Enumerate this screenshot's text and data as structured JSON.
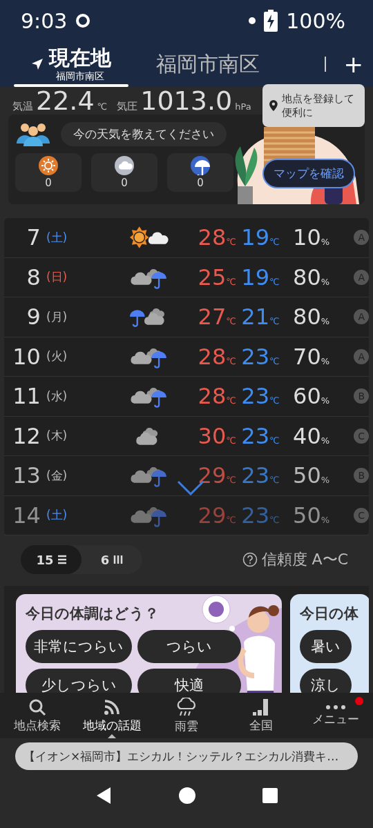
{
  "status_bar": {
    "time": "9:03",
    "battery": "100%"
  },
  "tabs": [
    {
      "label": "現在地",
      "sublabel": "福岡市南区",
      "selected": true
    },
    {
      "label": "福岡市南区",
      "selected": false
    }
  ],
  "add_button": "+",
  "current": {
    "temp_label": "気温",
    "temp": "22.4",
    "temp_unit": "℃",
    "pressure_label": "気圧",
    "pressure": "1013.0",
    "pressure_unit": "hPa"
  },
  "tooltip": "地点を登録して便利に",
  "report": {
    "prompt": "今の天気を教えてください",
    "counts": [
      {
        "kind": "sun",
        "count": "0"
      },
      {
        "kind": "cloud",
        "count": "0"
      },
      {
        "kind": "rain",
        "count": "0"
      }
    ],
    "map_button": "マップを確認"
  },
  "forecast": [
    {
      "day": "7",
      "weekday": "(土)",
      "color": "#4d8ff0",
      "kind": "sun-cloud",
      "high": "28",
      "low": "19",
      "pop": "10",
      "reliability": "A"
    },
    {
      "day": "8",
      "weekday": "(日)",
      "color": "#e8594e",
      "kind": "cloud-rain",
      "high": "25",
      "low": "19",
      "pop": "80",
      "reliability": "A"
    },
    {
      "day": "9",
      "weekday": "(月)",
      "color": "#bbbbbb",
      "kind": "rain-cloud",
      "high": "27",
      "low": "21",
      "pop": "80",
      "reliability": "A"
    },
    {
      "day": "10",
      "weekday": "(火)",
      "color": "#bbbbbb",
      "kind": "cloud-rain",
      "high": "28",
      "low": "23",
      "pop": "70",
      "reliability": "A"
    },
    {
      "day": "11",
      "weekday": "(水)",
      "color": "#bbbbbb",
      "kind": "cloud-rain",
      "high": "28",
      "low": "23",
      "pop": "60",
      "reliability": "B"
    },
    {
      "day": "12",
      "weekday": "(木)",
      "color": "#bbbbbb",
      "kind": "cloud",
      "high": "30",
      "low": "23",
      "pop": "40",
      "reliability": "C"
    },
    {
      "day": "13",
      "weekday": "(金)",
      "color": "#bbbbbb",
      "kind": "cloud-rain",
      "high": "29",
      "low": "23",
      "pop": "50",
      "reliability": "B"
    },
    {
      "day": "14",
      "weekday": "(土)",
      "color": "#4d8ff0",
      "kind": "cloud-rain",
      "high": "29",
      "low": "23",
      "pop": "50",
      "reliability": "C"
    }
  ],
  "temp_unit": "℃",
  "pop_unit": "%",
  "view_toggle": [
    {
      "label": "15",
      "kind": "list",
      "selected": true
    },
    {
      "label": "6",
      "kind": "columns",
      "selected": false
    }
  ],
  "reliability_label": "信頼度 A〜C",
  "cards": [
    {
      "title": "今日の体調はどう？",
      "kind": "lilac",
      "chips": [
        "非常につらい",
        "つらい",
        "少しつらい",
        "快適"
      ]
    },
    {
      "title": "今日の体",
      "kind": "blue",
      "chips": [
        "暑い",
        "涼し"
      ]
    }
  ],
  "bottom_nav": [
    {
      "label": "地点検索",
      "kind": "search",
      "selected": false,
      "badge": false
    },
    {
      "label": "地域の話題",
      "kind": "feed",
      "selected": true,
      "badge": false
    },
    {
      "label": "雨雲",
      "kind": "rain",
      "selected": false,
      "badge": false
    },
    {
      "label": "全国",
      "kind": "steps",
      "selected": false,
      "badge": false
    },
    {
      "label": "メニュー",
      "kind": "dots",
      "selected": false,
      "badge": true
    }
  ],
  "ticker": "【イオン×福岡市】エシカル！シッテル？エシカル消費キ…"
}
